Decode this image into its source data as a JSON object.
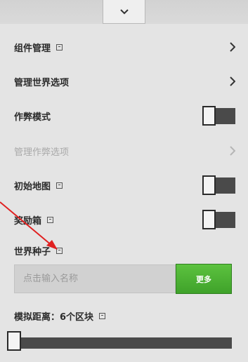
{
  "colors": {
    "accent_green": "#4cb234",
    "toggle_track": "#4a4a4a",
    "disabled_text": "#a9a9a9"
  },
  "collapse_tab": {
    "icon": "chevron-down-icon"
  },
  "rows": [
    {
      "label": "组件管理",
      "has_help": true,
      "control": "chevron"
    },
    {
      "label": "管理世界选项",
      "has_help": false,
      "control": "chevron"
    },
    {
      "label": "作弊模式",
      "has_help": false,
      "control": "toggle",
      "value": "off"
    },
    {
      "label": "管理作弊选项",
      "has_help": false,
      "control": "chevron",
      "disabled": true
    },
    {
      "label": "初始地图",
      "has_help": true,
      "control": "toggle",
      "value": "off"
    },
    {
      "label": "奖励箱",
      "has_help": true,
      "control": "toggle",
      "value": "off"
    }
  ],
  "seed": {
    "label": "世界种子",
    "placeholder": "点击输入名称",
    "button_label": "更多"
  },
  "sim_distance": {
    "label": "模拟距离：6个区块",
    "slider_level": 0
  }
}
